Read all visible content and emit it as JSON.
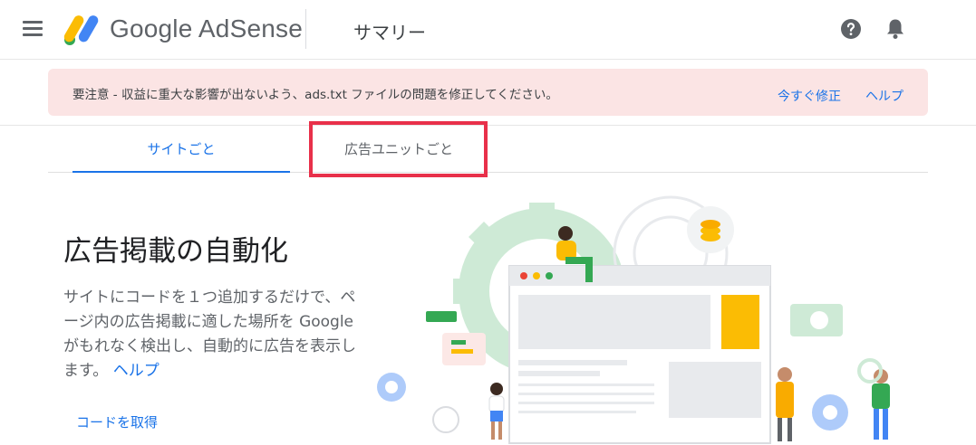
{
  "header": {
    "brand": "Google AdSense",
    "page_title": "サマリー"
  },
  "alert": {
    "message": "要注意 - 収益に重大な影響が出ないよう、ads.txt ファイルの問題を修正してください。",
    "fix_label": "今すぐ修正",
    "help_label": "ヘルプ"
  },
  "tabs": [
    {
      "label": "サイトごと",
      "selected": true
    },
    {
      "label": "広告ユニットごと",
      "selected": false
    }
  ],
  "main": {
    "heading": "広告掲載の自動化",
    "description": "サイトにコードを１つ追加するだけで、ページ内の広告掲載に適した場所を Google がもれなく検出し、自動的に広告を表示します。",
    "help_link": "ヘルプ",
    "get_code_label": "コードを取得"
  },
  "colors": {
    "accent": "#1a73e8",
    "alert_bg": "#fbe4e4",
    "highlight": "#e8304a"
  },
  "icons": {
    "menu": "hamburger-menu-icon",
    "help": "help-circle-icon",
    "notifications": "bell-icon"
  }
}
